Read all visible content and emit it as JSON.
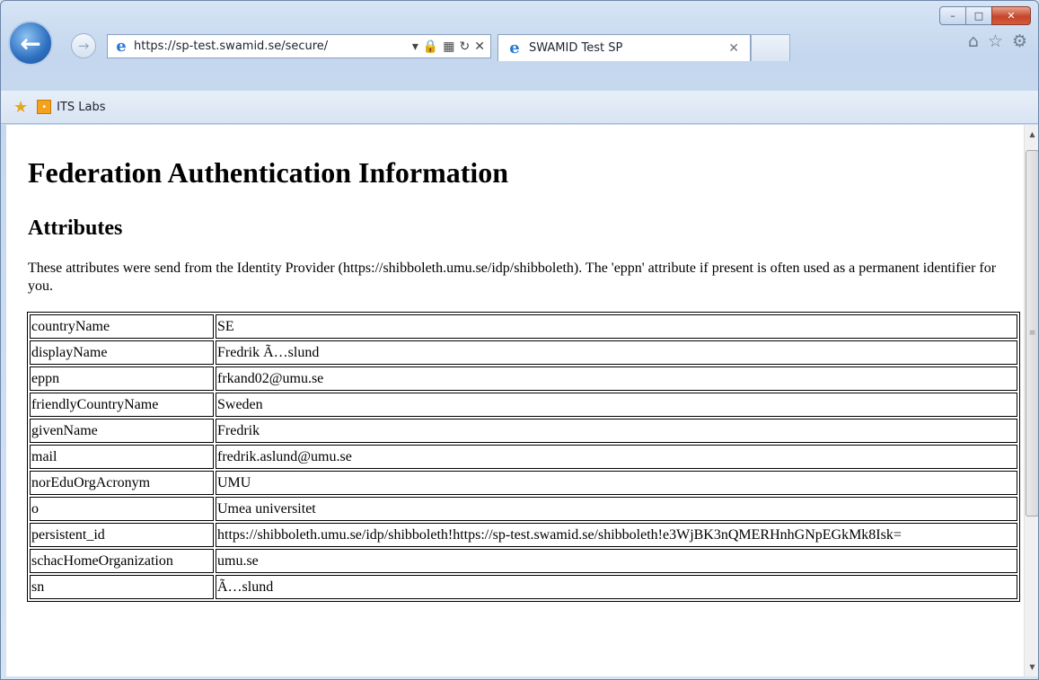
{
  "browser": {
    "address_url": "https://sp-test.swamid.se/secure/",
    "tab_title": "SWAMID Test SP",
    "favorites": [
      {
        "label": "ITS Labs"
      }
    ],
    "window_controls": {
      "minimize": "–",
      "maximize": "□",
      "close": "✕"
    },
    "icons": {
      "back": "back-arrow-icon",
      "forward": "forward-arrow-icon",
      "home": "home-icon",
      "favorites": "star-icon",
      "tools": "gear-icon"
    }
  },
  "page": {
    "title": "Federation Authentication Information",
    "section": "Attributes",
    "intro": "These attributes were send from the Identity Provider (https://shibboleth.umu.se/idp/shibboleth). The 'eppn' attribute if present is often used as a permanent identifier for you.",
    "attributes": [
      {
        "name": "countryName",
        "value": "SE"
      },
      {
        "name": "displayName",
        "value": "Fredrik Ã…slund"
      },
      {
        "name": "eppn",
        "value": "frkand02@umu.se"
      },
      {
        "name": "friendlyCountryName",
        "value": "Sweden"
      },
      {
        "name": "givenName",
        "value": "Fredrik"
      },
      {
        "name": "mail",
        "value": "fredrik.aslund@umu.se"
      },
      {
        "name": "norEduOrgAcronym",
        "value": "UMU"
      },
      {
        "name": "o",
        "value": "Umea universitet"
      },
      {
        "name": "persistent_id",
        "value": "https://shibboleth.umu.se/idp/shibboleth!https://sp-test.swamid.se/shibboleth!e3WjBK3nQMERHnhGNpEGkMk8Isk="
      },
      {
        "name": "schacHomeOrganization",
        "value": "umu.se"
      },
      {
        "name": "sn",
        "value": "Ã…slund"
      }
    ]
  }
}
